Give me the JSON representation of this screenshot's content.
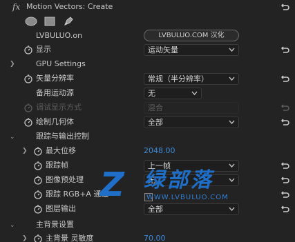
{
  "effect": {
    "fx_label": "fx",
    "title": "Motion Vectors: Create"
  },
  "credit": {
    "label": "LVBULUO.on",
    "button": "LVBULUO.COM 汉化"
  },
  "rows": {
    "display": {
      "label": "显示",
      "value": "运动矢量"
    },
    "gpu": {
      "label": "GPU Settings"
    },
    "vector_resolution": {
      "label": "矢量分辨率",
      "value": "常规（半分辨率）"
    },
    "backup_source": {
      "label": "备用运动源",
      "value": "无"
    },
    "debug_display": {
      "label": "调试显示方式",
      "value": "混合"
    },
    "draw_geometry": {
      "label": "绘制几何体",
      "value": "全部"
    },
    "tracking_output": {
      "label": "跟踪与输出控制"
    },
    "max_displacement": {
      "label": "最大位移",
      "value": "2048.00"
    },
    "track_frame": {
      "label": "跟踪帧",
      "value": "上一帧"
    },
    "image_preprocess": {
      "label": "图像预处理",
      "value": "无"
    },
    "track_rgba": {
      "label": "跟踪 RGB+A 通道"
    },
    "layer_output": {
      "label": "图层输出",
      "value": "全部"
    },
    "main_bg": {
      "label": "主背景设置"
    },
    "main_bg_sensitivity": {
      "label": "主背景 灵敏度",
      "value": "70.00"
    }
  },
  "watermark": {
    "letter": "Z",
    "chinese": "绿部落",
    "url": "WWW.LVBULUO.COM"
  },
  "colors": {
    "background": "#232323",
    "text": "#c8c8c8",
    "disabled": "#5e5e5e",
    "value_blue": "#3d8ad8",
    "watermark_blue": "#1f6fc9"
  }
}
